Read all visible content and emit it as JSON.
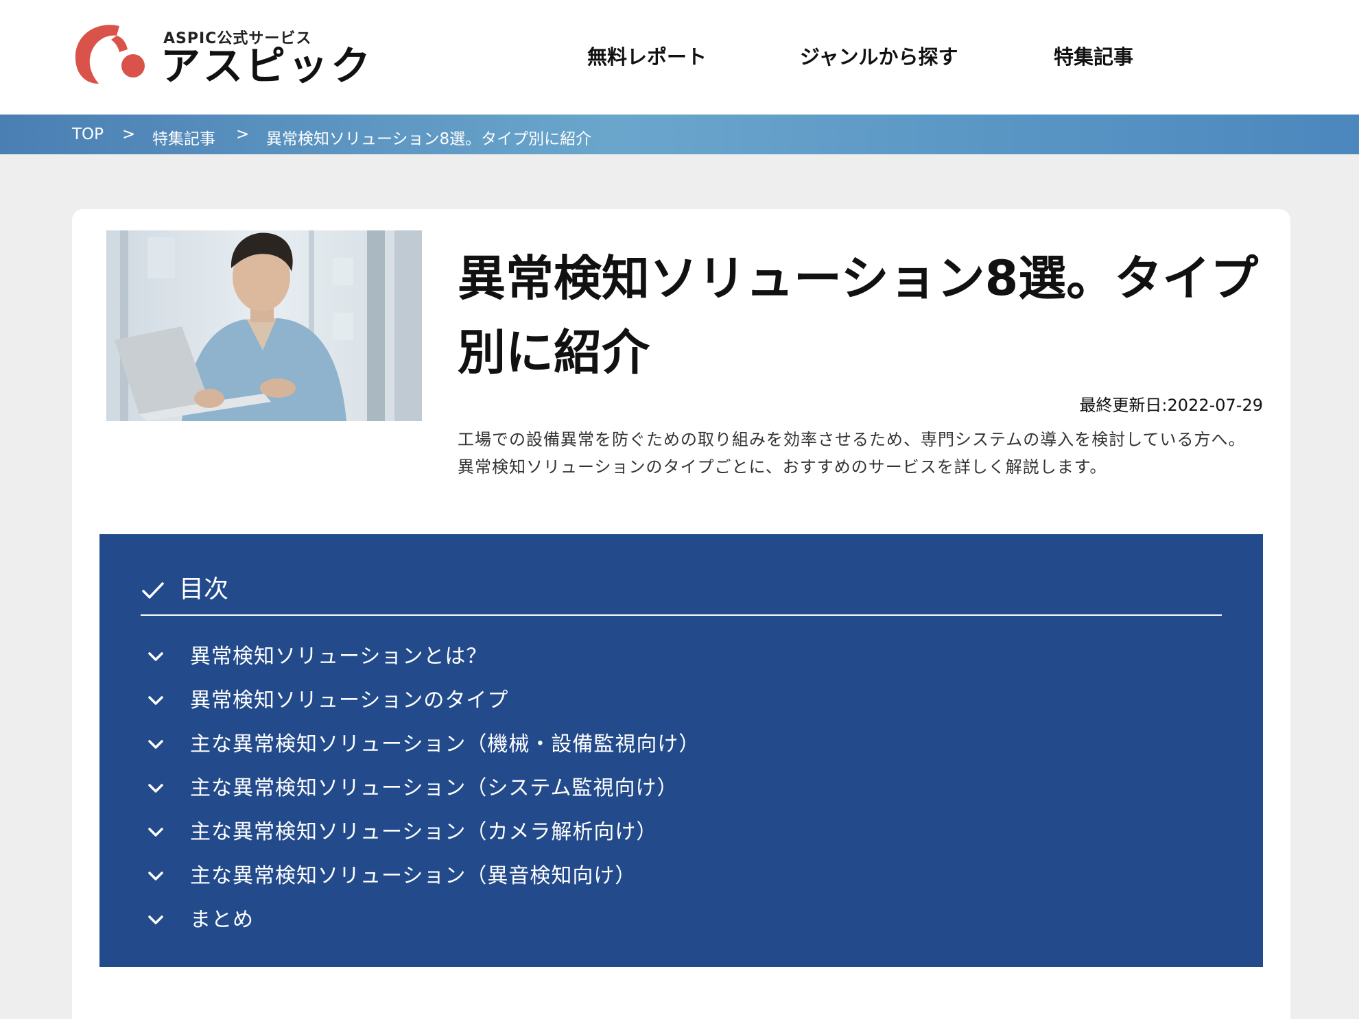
{
  "header": {
    "logo_sub": "ASPIC公式サービス",
    "logo_main": "アスピック",
    "nav": [
      "無料レポート",
      "ジャンルから探す",
      "特集記事"
    ]
  },
  "breadcrumb": {
    "items": [
      "TOP",
      "特集記事",
      "異常検知ソリューション8選。タイプ別に紹介"
    ],
    "separator": ">"
  },
  "article": {
    "title": "異常検知ソリューション8選。タイプ別に紹介",
    "updated": "最終更新日:2022-07-29",
    "description": "工場での設備異常を防ぐための取り組みを効率させるため、専門システムの導入を検討している方へ。異常検知ソリューションのタイプごとに、おすすめのサービスを詳しく解説します。"
  },
  "toc": {
    "heading": "目次",
    "items": [
      "異常検知ソリューションとは？",
      "異常検知ソリューションのタイプ",
      "主な異常検知ソリューション（機械・設備監視向け）",
      "主な異常検知ソリューション（システム監視向け）",
      "主な異常検知ソリューション（カメラ解析向け）",
      "主な異常検知ソリューション（異音検知向け）",
      "まとめ"
    ]
  },
  "colors": {
    "brand_red": "#d9534a",
    "toc_bg": "#234b8c",
    "breadcrumb_bg": "#5b97c5"
  },
  "icons": {
    "toc_heading": "check-icon",
    "toc_item": "chevron-down-icon"
  }
}
